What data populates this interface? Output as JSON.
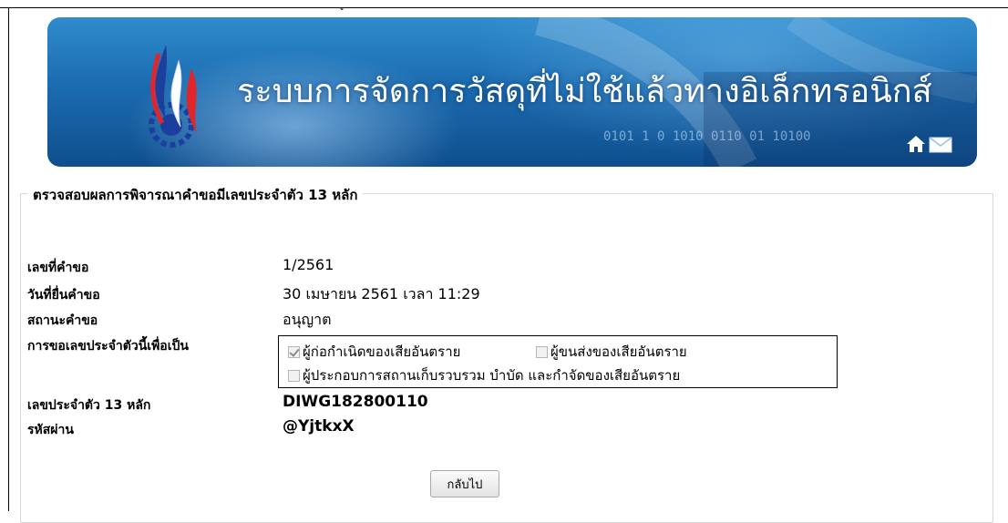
{
  "header": {
    "top_mark": "ู",
    "banner_title": "ระบบการจัดการวัสดุที่ไม่ใช้แล้วทางอิเล็กทรอนิกส์",
    "banner_digits": "0101 1 0 1010 0110 01 10100",
    "icons": {
      "home": "home-icon",
      "mail": "mail-icon"
    }
  },
  "form": {
    "legend": "ตรวจสอบผลการพิจารณาคำขอมีเลขประจำตัว 13 หลัก",
    "fields": {
      "request_no": {
        "label": "เลขที่คำขอ",
        "value": "1/2561"
      },
      "submit_date": {
        "label": "วันที่ยื่นคำขอ",
        "value": "30 เมษายน 2561 เวลา 11:29"
      },
      "status": {
        "label": "สถานะคำขอ",
        "value": "อนุญาต"
      },
      "purpose": {
        "label": "การขอเลขประจำตัวนี้เพื่อเป็น",
        "options": [
          {
            "label": "ผู้ก่อกำเนิดของเสียอันตราย",
            "checked": true
          },
          {
            "label": "ผู้ขนส่งของเสียอันตราย",
            "checked": false
          },
          {
            "label": "ผู้ประกอบการสถานเก็บรวบรวม บำบัด และกำจัดของเสียอันตราย",
            "checked": false
          }
        ]
      },
      "id_number": {
        "label": "เลขประจำตัว 13 หลัก",
        "value": "DIWG182800110"
      },
      "password": {
        "label": "รหัสผ่าน",
        "value": "@YjtkxX"
      }
    },
    "back_button": "กลับไป"
  },
  "colors": {
    "banner_top": "#2f8ccd",
    "banner_bottom": "#0f4f8e",
    "logo_red": "#e0262b",
    "logo_blue": "#1c3f9e"
  }
}
